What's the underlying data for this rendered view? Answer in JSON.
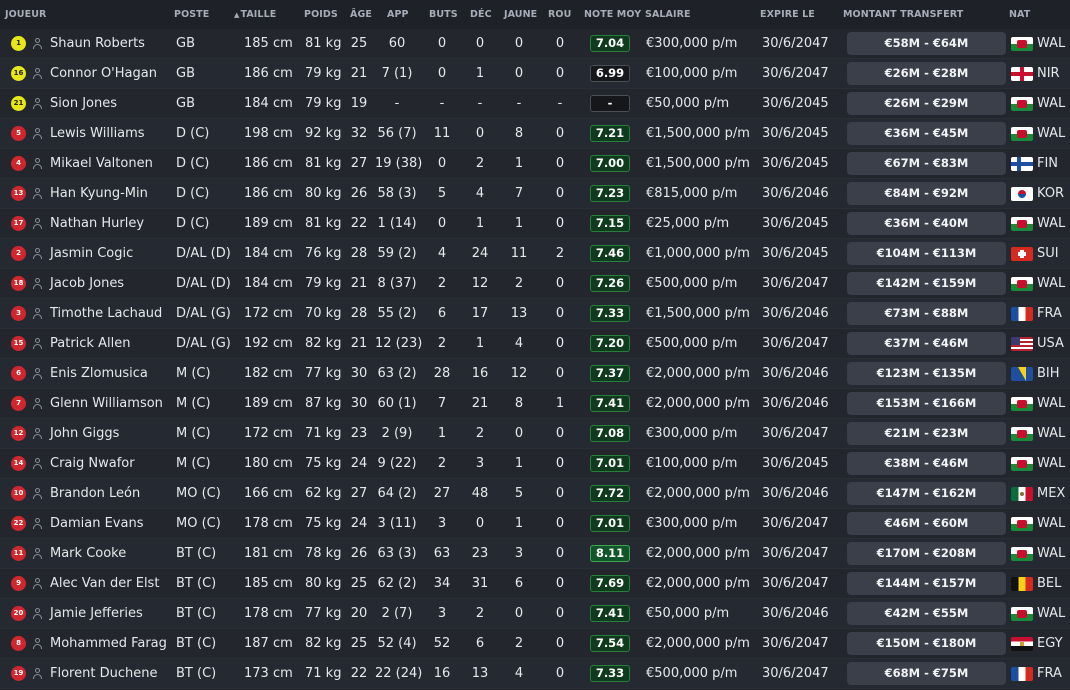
{
  "columns": {
    "player": "JOUEUR",
    "position": "POSTE",
    "height": "TAILLE",
    "weight": "POIDS",
    "age": "ÂGE",
    "apps": "APP",
    "goals": "BUTS",
    "dec": "DÉC",
    "yellow": "JAUNE",
    "red": "ROU",
    "avg_rating": "NOTE MOY",
    "wage": "SALAIRE",
    "expires": "EXPIRE LE",
    "transfer": "MONTANT TRANSFERT",
    "nat": "NAT"
  },
  "sort_arrow": "▲",
  "players": [
    {
      "num": "1",
      "gk": true,
      "name": "Shaun Roberts",
      "pos": "GB",
      "height": "185 cm",
      "weight": "81 kg",
      "age": "25",
      "apps": "60",
      "goals": "0",
      "dec": "0",
      "yellow": "0",
      "red": "0",
      "rating": "7.04",
      "wage": "€300,000 p/m",
      "expires": "30/6/2047",
      "transfer": "€58M - €64M",
      "flag": "wal",
      "nat": "WAL"
    },
    {
      "num": "16",
      "gk": true,
      "name": "Connor O'Hagan",
      "pos": "GB",
      "height": "186 cm",
      "weight": "79 kg",
      "age": "21",
      "apps": "7 (1)",
      "goals": "0",
      "dec": "1",
      "yellow": "0",
      "red": "0",
      "rating": "6.99",
      "wage": "€100,000 p/m",
      "expires": "30/6/2047",
      "transfer": "€26M - €28M",
      "flag": "nir",
      "nat": "NIR"
    },
    {
      "num": "21",
      "gk": true,
      "name": "Sion Jones",
      "pos": "GB",
      "height": "184 cm",
      "weight": "79 kg",
      "age": "19",
      "apps": "-",
      "goals": "-",
      "dec": "-",
      "yellow": "-",
      "red": "-",
      "rating": "-",
      "wage": "€50,000 p/m",
      "expires": "30/6/2045",
      "transfer": "€26M - €29M",
      "flag": "wal",
      "nat": "WAL"
    },
    {
      "num": "5",
      "gk": false,
      "name": "Lewis Williams",
      "pos": "D (C)",
      "height": "198 cm",
      "weight": "92 kg",
      "age": "32",
      "apps": "56 (7)",
      "goals": "11",
      "dec": "0",
      "yellow": "8",
      "red": "0",
      "rating": "7.21",
      "wage": "€1,500,000 p/m",
      "expires": "30/6/2045",
      "transfer": "€36M - €45M",
      "flag": "wal",
      "nat": "WAL"
    },
    {
      "num": "4",
      "gk": false,
      "name": "Mikael Valtonen",
      "pos": "D (C)",
      "height": "186 cm",
      "weight": "81 kg",
      "age": "27",
      "apps": "19 (38)",
      "goals": "0",
      "dec": "2",
      "yellow": "1",
      "red": "0",
      "rating": "7.00",
      "wage": "€1,500,000 p/m",
      "expires": "30/6/2045",
      "transfer": "€67M - €83M",
      "flag": "fin",
      "nat": "FIN"
    },
    {
      "num": "13",
      "gk": false,
      "name": "Han Kyung-Min",
      "pos": "D (C)",
      "height": "186 cm",
      "weight": "80 kg",
      "age": "26",
      "apps": "58 (3)",
      "goals": "5",
      "dec": "4",
      "yellow": "7",
      "red": "0",
      "rating": "7.23",
      "wage": "€815,000 p/m",
      "expires": "30/6/2046",
      "transfer": "€84M - €92M",
      "flag": "kor",
      "nat": "KOR"
    },
    {
      "num": "17",
      "gk": false,
      "name": "Nathan Hurley",
      "pos": "D (C)",
      "height": "189 cm",
      "weight": "81 kg",
      "age": "22",
      "apps": "1 (14)",
      "goals": "0",
      "dec": "1",
      "yellow": "1",
      "red": "0",
      "rating": "7.15",
      "wage": "€25,000 p/m",
      "expires": "30/6/2045",
      "transfer": "€36M - €40M",
      "flag": "wal",
      "nat": "WAL"
    },
    {
      "num": "2",
      "gk": false,
      "name": "Jasmin Cogic",
      "pos": "D/AL (D)",
      "height": "184 cm",
      "weight": "76 kg",
      "age": "28",
      "apps": "59 (2)",
      "goals": "4",
      "dec": "24",
      "yellow": "11",
      "red": "2",
      "rating": "7.46",
      "wage": "€1,000,000 p/m",
      "expires": "30/6/2045",
      "transfer": "€104M - €113M",
      "flag": "sui",
      "nat": "SUI"
    },
    {
      "num": "18",
      "gk": false,
      "name": "Jacob Jones",
      "pos": "D/AL (D)",
      "height": "184 cm",
      "weight": "79 kg",
      "age": "21",
      "apps": "8 (37)",
      "goals": "2",
      "dec": "12",
      "yellow": "2",
      "red": "0",
      "rating": "7.26",
      "wage": "€500,000 p/m",
      "expires": "30/6/2047",
      "transfer": "€142M - €159M",
      "flag": "wal",
      "nat": "WAL"
    },
    {
      "num": "3",
      "gk": false,
      "name": "Timothe Lachaud",
      "pos": "D/AL (G)",
      "height": "172 cm",
      "weight": "70 kg",
      "age": "28",
      "apps": "55 (2)",
      "goals": "6",
      "dec": "17",
      "yellow": "13",
      "red": "0",
      "rating": "7.33",
      "wage": "€1,500,000 p/m",
      "expires": "30/6/2046",
      "transfer": "€73M - €88M",
      "flag": "fra",
      "nat": "FRA"
    },
    {
      "num": "15",
      "gk": false,
      "name": "Patrick Allen",
      "pos": "D/AL (G)",
      "height": "192 cm",
      "weight": "82 kg",
      "age": "21",
      "apps": "12 (23)",
      "goals": "2",
      "dec": "1",
      "yellow": "4",
      "red": "0",
      "rating": "7.20",
      "wage": "€500,000 p/m",
      "expires": "30/6/2047",
      "transfer": "€37M - €46M",
      "flag": "usa",
      "nat": "USA"
    },
    {
      "num": "6",
      "gk": false,
      "name": "Enis Zlomusica",
      "pos": "M (C)",
      "height": "182 cm",
      "weight": "77 kg",
      "age": "30",
      "apps": "63 (2)",
      "goals": "28",
      "dec": "16",
      "yellow": "12",
      "red": "0",
      "rating": "7.37",
      "wage": "€2,000,000 p/m",
      "expires": "30/6/2046",
      "transfer": "€123M - €135M",
      "flag": "bih",
      "nat": "BIH"
    },
    {
      "num": "7",
      "gk": false,
      "name": "Glenn Williamson",
      "pos": "M (C)",
      "height": "189 cm",
      "weight": "87 kg",
      "age": "30",
      "apps": "60 (1)",
      "goals": "7",
      "dec": "21",
      "yellow": "8",
      "red": "1",
      "rating": "7.41",
      "wage": "€2,000,000 p/m",
      "expires": "30/6/2046",
      "transfer": "€153M - €166M",
      "flag": "wal",
      "nat": "WAL"
    },
    {
      "num": "12",
      "gk": false,
      "name": "John Giggs",
      "pos": "M (C)",
      "height": "172 cm",
      "weight": "71 kg",
      "age": "23",
      "apps": "2 (9)",
      "goals": "1",
      "dec": "2",
      "yellow": "0",
      "red": "0",
      "rating": "7.08",
      "wage": "€300,000 p/m",
      "expires": "30/6/2047",
      "transfer": "€21M - €23M",
      "flag": "wal",
      "nat": "WAL"
    },
    {
      "num": "14",
      "gk": false,
      "name": "Craig Nwafor",
      "pos": "M (C)",
      "height": "180 cm",
      "weight": "75 kg",
      "age": "24",
      "apps": "9 (22)",
      "goals": "2",
      "dec": "3",
      "yellow": "1",
      "red": "0",
      "rating": "7.01",
      "wage": "€100,000 p/m",
      "expires": "30/6/2045",
      "transfer": "€38M - €46M",
      "flag": "wal",
      "nat": "WAL"
    },
    {
      "num": "10",
      "gk": false,
      "name": "Brandon León",
      "pos": "MO (C)",
      "height": "166 cm",
      "weight": "62 kg",
      "age": "27",
      "apps": "64 (2)",
      "goals": "27",
      "dec": "48",
      "yellow": "5",
      "red": "0",
      "rating": "7.72",
      "wage": "€2,000,000 p/m",
      "expires": "30/6/2046",
      "transfer": "€147M - €162M",
      "flag": "mex",
      "nat": "MEX"
    },
    {
      "num": "22",
      "gk": false,
      "name": "Damian Evans",
      "pos": "MO (C)",
      "height": "178 cm",
      "weight": "75 kg",
      "age": "24",
      "apps": "3 (11)",
      "goals": "3",
      "dec": "0",
      "yellow": "1",
      "red": "0",
      "rating": "7.01",
      "wage": "€300,000 p/m",
      "expires": "30/6/2047",
      "transfer": "€46M - €60M",
      "flag": "wal",
      "nat": "WAL"
    },
    {
      "num": "11",
      "gk": false,
      "name": "Mark Cooke",
      "pos": "BT (C)",
      "height": "181 cm",
      "weight": "78 kg",
      "age": "26",
      "apps": "63 (3)",
      "goals": "63",
      "dec": "23",
      "yellow": "3",
      "red": "0",
      "rating": "8.11",
      "wage": "€2,000,000 p/m",
      "expires": "30/6/2047",
      "transfer": "€170M - €208M",
      "flag": "wal",
      "nat": "WAL"
    },
    {
      "num": "9",
      "gk": false,
      "name": "Alec Van der Elst",
      "pos": "BT (C)",
      "height": "185 cm",
      "weight": "80 kg",
      "age": "25",
      "apps": "62 (2)",
      "goals": "34",
      "dec": "31",
      "yellow": "6",
      "red": "0",
      "rating": "7.69",
      "wage": "€2,000,000 p/m",
      "expires": "30/6/2047",
      "transfer": "€144M - €157M",
      "flag": "bel",
      "nat": "BEL"
    },
    {
      "num": "20",
      "gk": false,
      "name": "Jamie Jefferies",
      "pos": "BT (C)",
      "height": "178 cm",
      "weight": "77 kg",
      "age": "20",
      "apps": "2 (7)",
      "goals": "3",
      "dec": "2",
      "yellow": "0",
      "red": "0",
      "rating": "7.41",
      "wage": "€50,000 p/m",
      "expires": "30/6/2046",
      "transfer": "€42M - €55M",
      "flag": "wal",
      "nat": "WAL"
    },
    {
      "num": "8",
      "gk": false,
      "name": "Mohammed Farag",
      "pos": "BT (C)",
      "height": "187 cm",
      "weight": "82 kg",
      "age": "25",
      "apps": "52 (4)",
      "goals": "52",
      "dec": "6",
      "yellow": "2",
      "red": "0",
      "rating": "7.54",
      "wage": "€2,000,000 p/m",
      "expires": "30/6/2047",
      "transfer": "€150M - €180M",
      "flag": "egy",
      "nat": "EGY"
    },
    {
      "num": "19",
      "gk": false,
      "name": "Florent Duchene",
      "pos": "BT (C)",
      "height": "173 cm",
      "weight": "71 kg",
      "age": "22",
      "apps": "22 (24)",
      "goals": "16",
      "dec": "13",
      "yellow": "4",
      "red": "0",
      "rating": "7.33",
      "wage": "€500,000 p/m",
      "expires": "30/6/2047",
      "transfer": "€68M - €75M",
      "flag": "fra",
      "nat": "FRA"
    }
  ]
}
